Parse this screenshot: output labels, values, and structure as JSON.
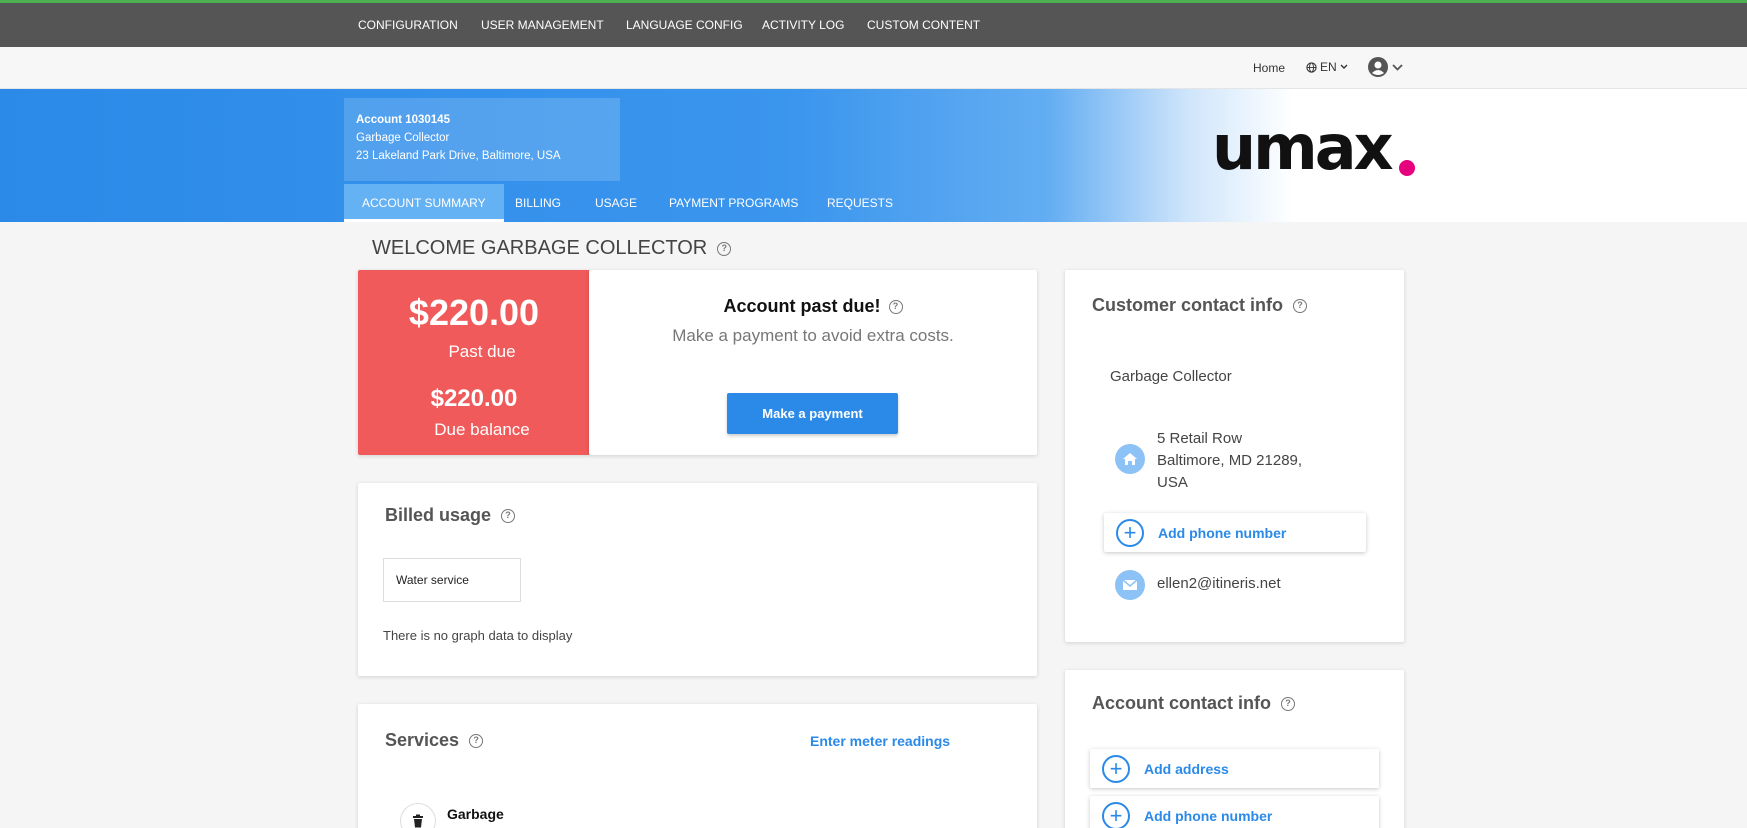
{
  "topnav": {
    "items": [
      "CONFIGURATION",
      "USER MANAGEMENT",
      "LANGUAGE CONFIG",
      "ACTIVITY LOG",
      "CUSTOM CONTENT"
    ]
  },
  "subbar": {
    "home": "Home",
    "language": "EN"
  },
  "account": {
    "number": "Account 1030145",
    "name": "Garbage Collector",
    "address": "23 Lakeland Park Drive, Baltimore, USA"
  },
  "brand": {
    "logo_text": "umax",
    "accent_color": "#e6007e",
    "primary_color": "#2b8ae8",
    "alert_color": "#f05a5a"
  },
  "tabs": [
    "ACCOUNT SUMMARY",
    "BILLING",
    "USAGE",
    "PAYMENT PROGRAMS",
    "REQUESTS"
  ],
  "welcome": "WELCOME GARBAGE COLLECTOR",
  "balance": {
    "past_due_amount": "$220.00",
    "past_due_label": "Past due",
    "due_amount": "$220.00",
    "due_label": "Due balance"
  },
  "alert": {
    "title": "Account past due!",
    "message": "Make a payment to avoid extra costs.",
    "button": "Make a payment"
  },
  "billed_usage": {
    "title": "Billed usage",
    "selected_service": "Water service",
    "empty_message": "There is no graph data to display"
  },
  "services": {
    "title": "Services",
    "meter_link": "Enter meter readings",
    "items": [
      "Garbage"
    ]
  },
  "customer_contact": {
    "title": "Customer contact info",
    "name": "Garbage Collector",
    "address_line1": "5 Retail Row",
    "address_line2": "Baltimore, MD 21289,",
    "address_line3": "USA",
    "add_phone": "Add phone number",
    "email": "ellen2@itineris.net"
  },
  "account_contact": {
    "title": "Account contact info",
    "add_address": "Add address",
    "add_phone": "Add phone number"
  }
}
